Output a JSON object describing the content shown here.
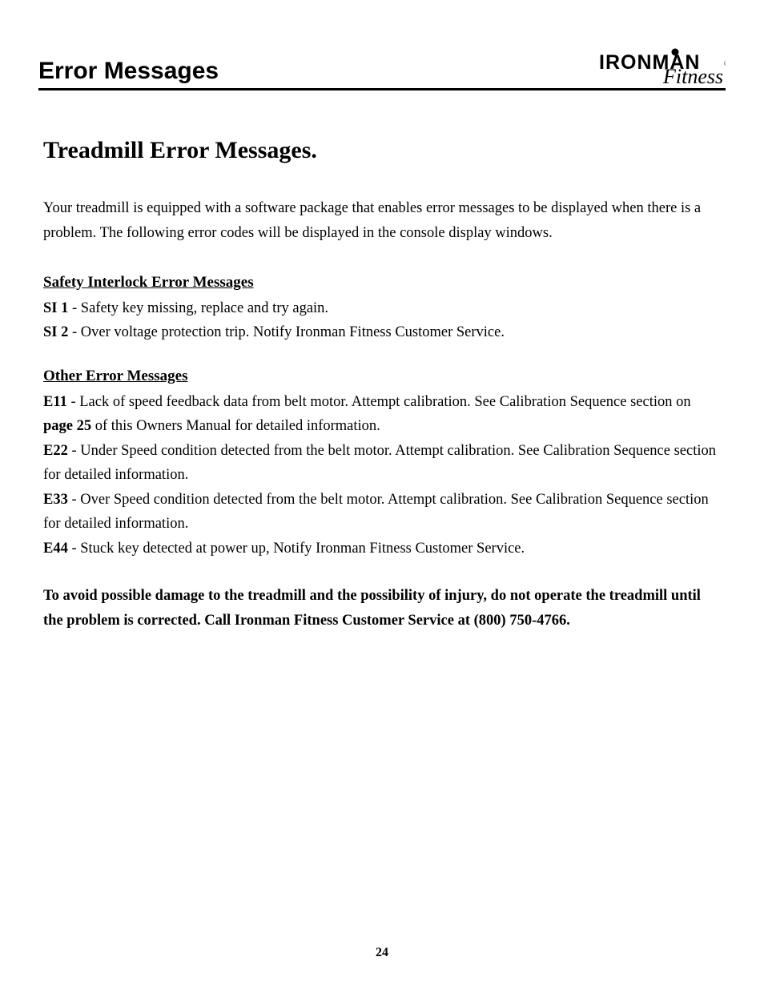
{
  "header": {
    "title": "Error Messages",
    "logo_top": "IRONMAN",
    "logo_bottom": "Fitness"
  },
  "section_title": "Treadmill Error Messages",
  "section_title_suffix": ".",
  "intro": "Your treadmill is equipped with a software package that enables error messages to be displayed when there is a problem. The following error codes will be displayed in the console display windows.",
  "safety": {
    "heading": "Safety Interlock Error Messages",
    "items": [
      {
        "code": "SI 1",
        "text": " - Safety key missing, replace and try again."
      },
      {
        "code": "SI 2",
        "text": " - Over voltage protection trip. Notify Ironman Fitness Customer Service."
      }
    ]
  },
  "other": {
    "heading": "Other Error Messages",
    "items": [
      {
        "code": "E11",
        "pre": " - Lack of speed feedback data from belt motor. Attempt calibration. See Calibration Sequence section on ",
        "boldref": "page 25",
        "post": " of this Owners Manual for detailed information."
      },
      {
        "code": "E22",
        "pre": " - Under Speed condition detected from the belt motor. Attempt calibration. See Calibration Sequence section for detailed information.",
        "boldref": "",
        "post": ""
      },
      {
        "code": "E33",
        "pre": " - Over Speed condition detected from the belt motor. Attempt calibration. See Calibration Sequence section for detailed information.",
        "boldref": "",
        "post": ""
      },
      {
        "code": "E44",
        "pre": " - Stuck key detected at power up, Notify Ironman Fitness Customer Service.",
        "boldref": "",
        "post": ""
      }
    ]
  },
  "warning": "To avoid possible damage to the treadmill and the possibility of injury, do not operate the treadmill until the problem is corrected. Call Ironman Fitness Customer Service at (800) 750-4766.",
  "page_number": "24"
}
